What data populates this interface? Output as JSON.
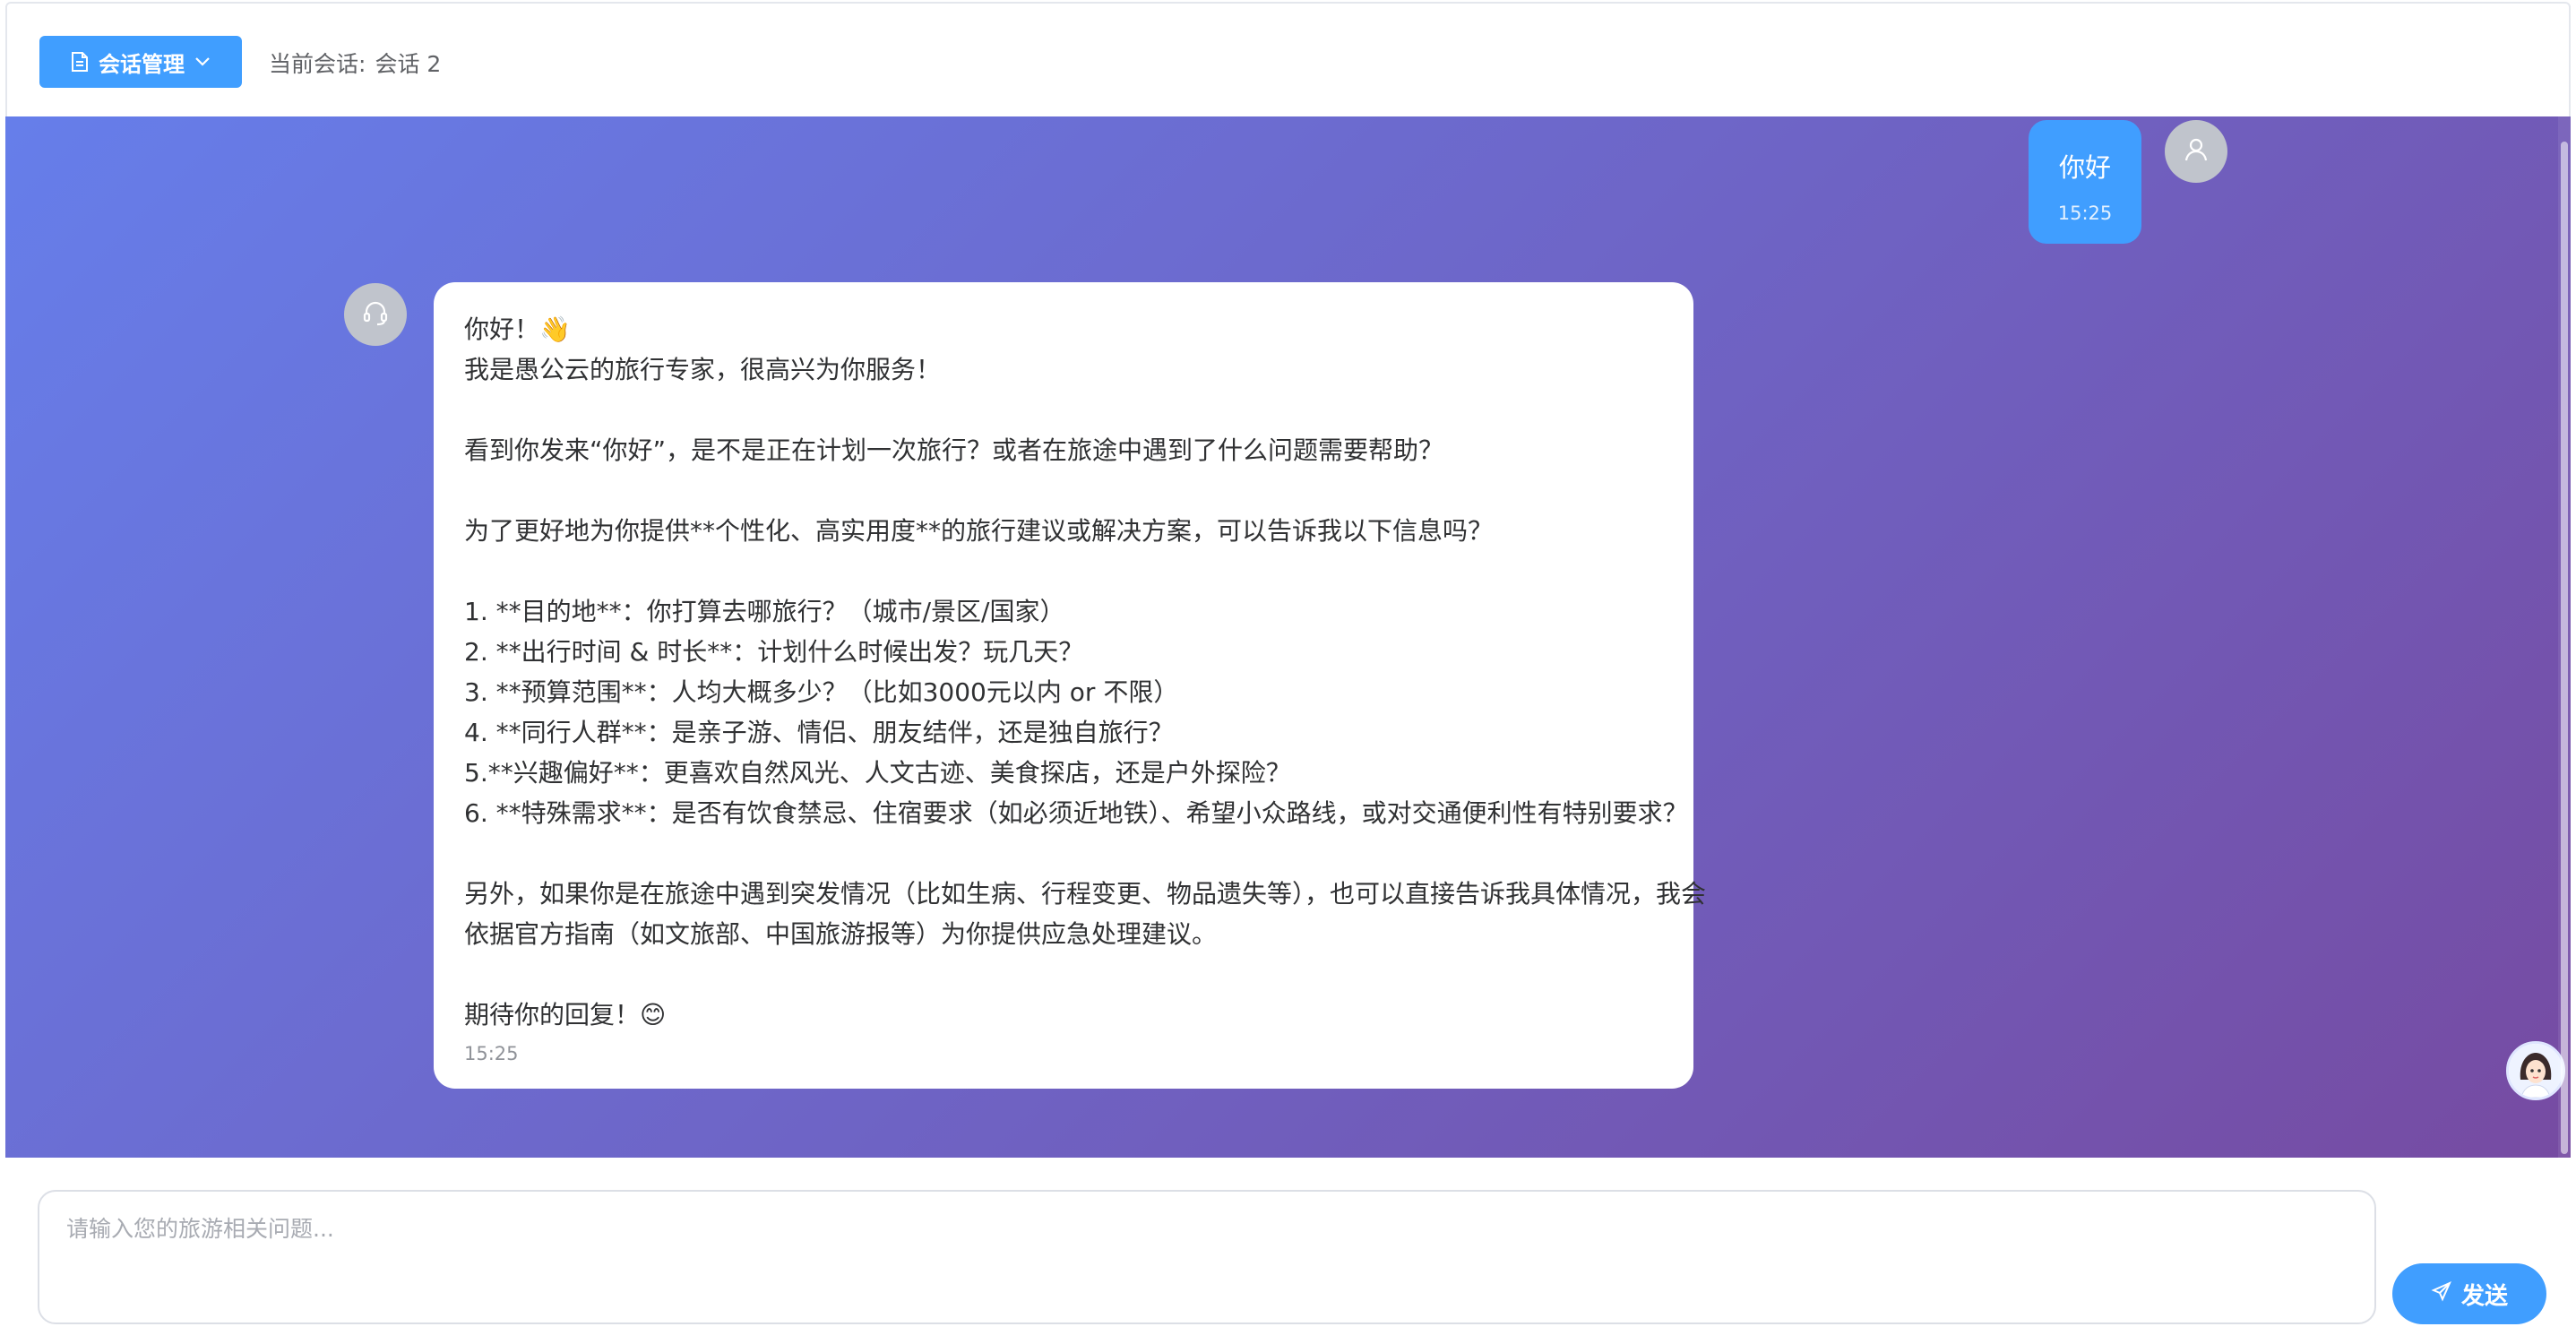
{
  "header": {
    "session_menu_label": "会话管理",
    "current_session_label": "当前会话:",
    "current_session_name": "会话 2"
  },
  "chat": {
    "messages": [
      {
        "role": "user",
        "text": "你好",
        "time": "15:25"
      },
      {
        "role": "assistant",
        "lines": [
          "你好！👋",
          "我是愚公云的旅行专家，很高兴为你服务！",
          "",
          "看到你发来“你好”，是不是正在计划一次旅行？或者在旅途中遇到了什么问题需要帮助？",
          "",
          "为了更好地为你提供**个性化、高实用度**的旅行建议或解决方案，可以告诉我以下信息吗？",
          "",
          "1. **目的地**：你打算去哪旅行？（城市/景区/国家）",
          "2. **出行时间 & 时长**：计划什么时候出发？玩几天？",
          "3. **预算范围**：人均大概多少？（比如3000元以内 or 不限）",
          "4. **同行人群**：是亲子游、情侣、朋友结伴，还是独自旅行？",
          "5.**兴趣偏好**：更喜欢自然风光、人文古迹、美食探店，还是户外探险？",
          "6. **特殊需求**：是否有饮食禁忌、住宿要求（如必须近地铁）、希望小众路线，或对交通便利性有特别要求？",
          "",
          "另外，如果你是在旅途中遇到突发情况（比如生病、行程变更、物品遗失等），也可以直接告诉我具体情况，我会",
          "依据官方指南（如文旅部、中国旅游报等）为你提供应急处理建议。",
          "",
          "期待你的回复！😊"
        ],
        "time": "15:25"
      }
    ]
  },
  "footer": {
    "input_placeholder": "请输入您的旅游相关问题...",
    "send_label": "发送"
  },
  "colors": {
    "primary": "#409eff",
    "gradient_start": "#667eea",
    "gradient_end": "#764ba2"
  }
}
